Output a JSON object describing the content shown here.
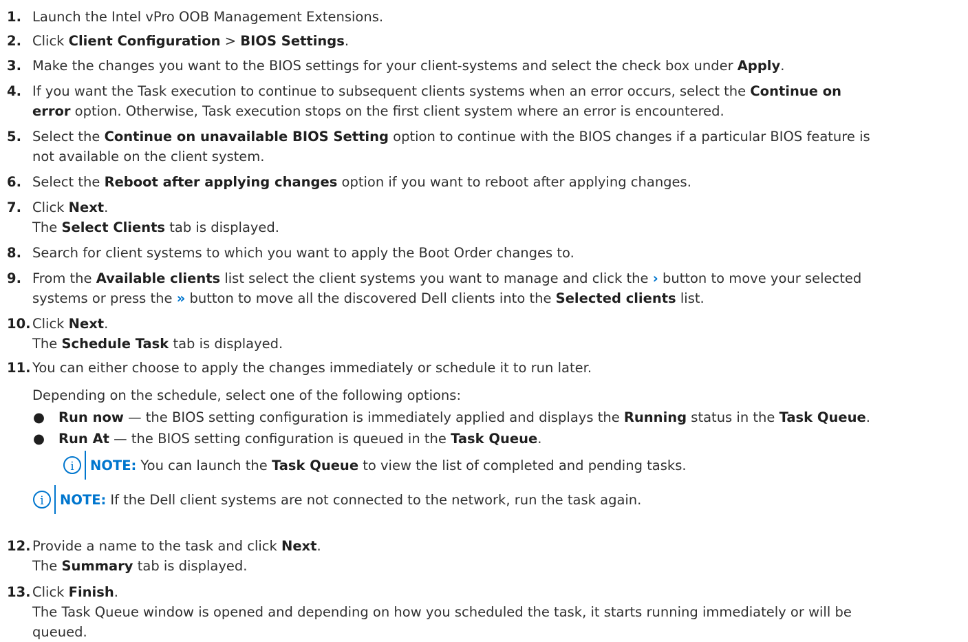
{
  "steps": {
    "s1": {
      "num": "1.",
      "text": "Launch the Intel vPro OOB Management Extensions."
    },
    "s2": {
      "num": "2.",
      "t1": "Click ",
      "b1": "Client Configuration",
      "t2": " > ",
      "b2": "BIOS Settings",
      "t3": "."
    },
    "s3": {
      "num": "3.",
      "t1": "Make the changes you want to the BIOS settings for your client-systems and select the check box under ",
      "b1": "Apply",
      "t2": "."
    },
    "s4": {
      "num": "4.",
      "t1": "If you want the Task execution to continue to subsequent clients systems when an error occurs, select the ",
      "b1": "Continue on",
      "b2": "error",
      "t2": " option. Otherwise, Task execution stops on the first client system where an error is encountered."
    },
    "s5": {
      "num": "5.",
      "t1": "Select the ",
      "b1": "Continue on unavailable BIOS Setting",
      "t2": " option to continue with the BIOS changes if a particular BIOS feature is",
      "t3": "not available on the client system."
    },
    "s6": {
      "num": "6.",
      "t1": "Select the ",
      "b1": "Reboot after applying changes",
      "t2": " option if you want to reboot after applying changes."
    },
    "s7": {
      "num": "7.",
      "t1": "Click ",
      "b1": "Next",
      "t2": ".",
      "t3": "The ",
      "b2": "Select Clients",
      "t4": " tab is displayed."
    },
    "s8": {
      "num": "8.",
      "text": "Search for client systems to which you want to apply the Boot Order changes to."
    },
    "s9": {
      "num": "9.",
      "t1": "From the ",
      "b1": "Available clients",
      "t2": " list select the client systems you want to manage and click the ",
      "chev1": "›",
      "t3": " button to move your selected",
      "t4": "systems or press the ",
      "chev2": "»",
      "t5": " button to move all the discovered Dell clients into the ",
      "b2": "Selected clients",
      "t6": " list."
    },
    "s10": {
      "num": "10.",
      "t1": "Click ",
      "b1": "Next",
      "t2": ".",
      "t3": "The ",
      "b2": "Schedule Task",
      "t4": " tab is displayed."
    },
    "s11": {
      "num": "11.",
      "text": "You can either choose to apply the changes immediately or schedule it to run later.",
      "subtext": "Depending on the schedule, select one of the following options:",
      "bullets": [
        {
          "dot": "●",
          "b1": "Run now",
          "t1": " — the BIOS setting configuration is immediately applied and displays the ",
          "b2": "Running",
          "t2": " status in the ",
          "b3": "Task Queue",
          "t3": "."
        },
        {
          "dot": "●",
          "b1": "Run At",
          "t1": " — the BIOS setting configuration is queued in the ",
          "b2": "Task Queue",
          "t2": "."
        }
      ],
      "note_inner": {
        "icon": "i",
        "label": "NOTE:",
        "t1": "You can launch the ",
        "b1": "Task Queue",
        "t2": " to view the list of completed and pending tasks."
      }
    },
    "note_outer": {
      "icon": "i",
      "label": "NOTE:",
      "text": "If the Dell client systems are not connected to the network, run the task again."
    },
    "s12": {
      "num": "12.",
      "t1": "Provide a name to the task and click ",
      "b1": "Next",
      "t2": ".",
      "t3": "The ",
      "b2": "Summary",
      "t4": " tab is displayed."
    },
    "s13": {
      "num": "13.",
      "t1": "Click ",
      "b1": "Finish",
      "t2": ".",
      "t3": "The Task Queue window is opened and depending on how you scheduled the task, it starts running immediately or will be",
      "t4": "queued."
    }
  },
  "colors": {
    "accent": "#0076ce",
    "text": "#303030"
  },
  "icons": [
    "info-icon",
    "chevron-right-icon",
    "double-chevron-right-icon"
  ]
}
